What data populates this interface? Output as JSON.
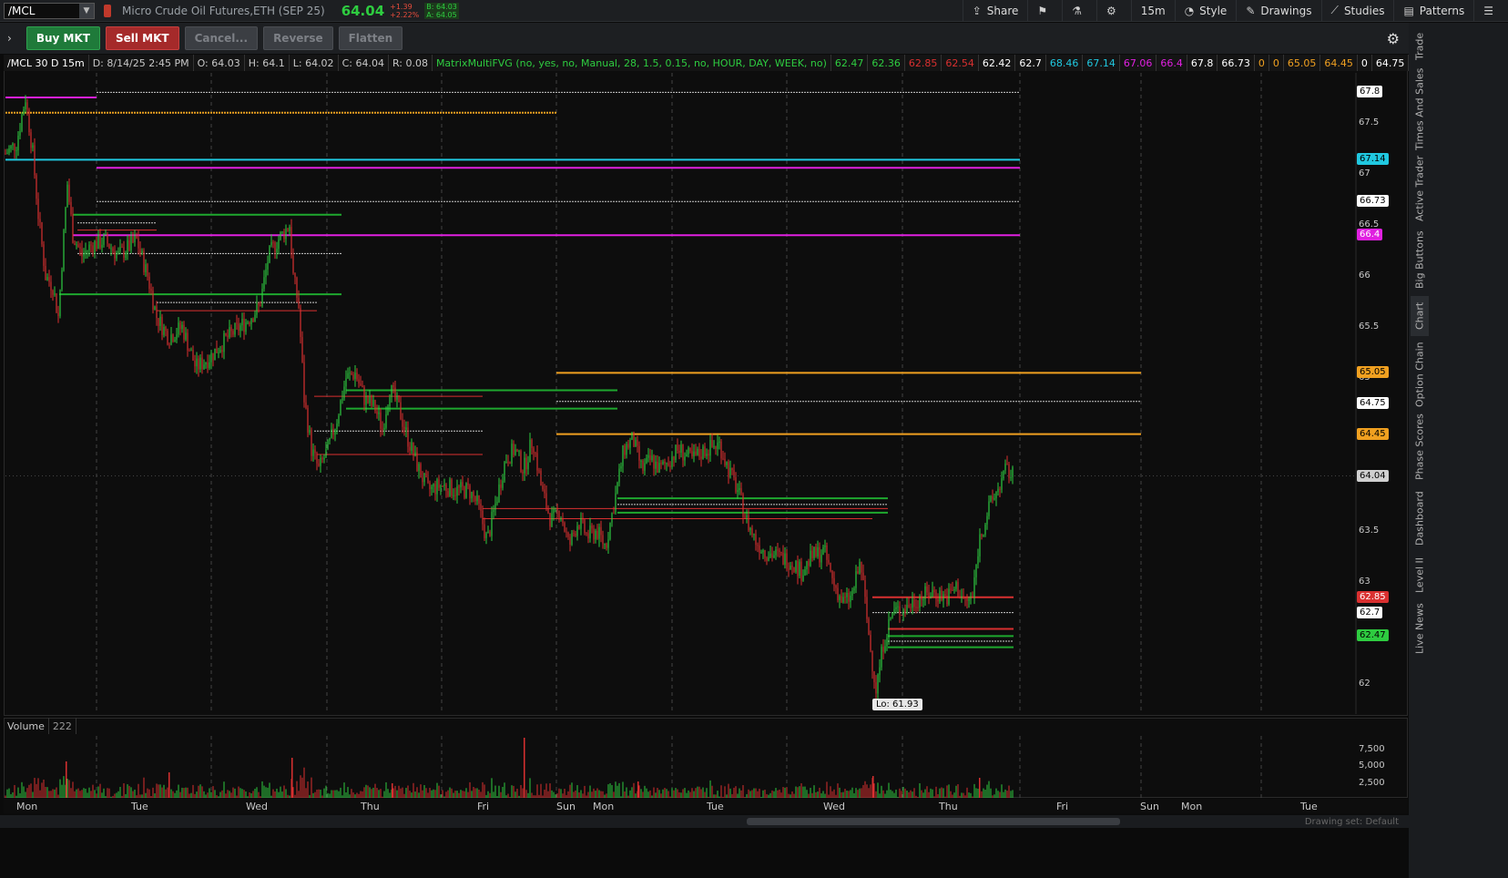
{
  "header": {
    "symbol": "/MCL",
    "description": "Micro Crude Oil Futures,ETH (SEP 25)",
    "last": "64.04",
    "change": "+1.39",
    "change_pct": "+2.22%",
    "bid": "B: 64.03",
    "ask": "A: 64.05",
    "toolbar": {
      "share": "Share",
      "timeframe": "15m",
      "style": "Style",
      "drawings": "Drawings",
      "studies": "Studies",
      "patterns": "Patterns"
    }
  },
  "orderbar": {
    "buy": "Buy MKT",
    "sell": "Sell MKT",
    "cancel": "Cancel...",
    "reverse": "Reverse",
    "flatten": "Flatten"
  },
  "sidetabs": [
    "Trade",
    "Times And Sales",
    "Active Trader",
    "Big Buttons",
    "Chart",
    "Option Chain",
    "Phase Scores",
    "Dashboard",
    "Level II",
    "Live News"
  ],
  "legend": {
    "symbol": "/MCL 30 D 15m",
    "date": "D: 8/14/25 2:45 PM",
    "open": "O: 64.03",
    "high": "H: 64.1",
    "low": "L: 64.02",
    "close": "C: 64.04",
    "range": "R: 0.08",
    "study": "MatrixMultiFVG (no, yes, no, Manual, 28, 1.5, 0.15, no, HOUR, DAY, WEEK, no)",
    "values": [
      {
        "v": "62.47",
        "c": "#2ecc40"
      },
      {
        "v": "62.36",
        "c": "#2ecc40"
      },
      {
        "v": "62.85",
        "c": "#d93030"
      },
      {
        "v": "62.54",
        "c": "#d93030"
      },
      {
        "v": "62.42",
        "c": "#ffffff"
      },
      {
        "v": "62.7",
        "c": "#ffffff"
      },
      {
        "v": "68.46",
        "c": "#20c8e0"
      },
      {
        "v": "67.14",
        "c": "#20c8e0"
      },
      {
        "v": "67.06",
        "c": "#e020e0"
      },
      {
        "v": "66.4",
        "c": "#e020e0"
      },
      {
        "v": "67.8",
        "c": "#ffffff"
      },
      {
        "v": "66.73",
        "c": "#ffffff"
      },
      {
        "v": "0",
        "c": "#f0a020"
      },
      {
        "v": "0",
        "c": "#f0a020"
      },
      {
        "v": "65.05",
        "c": "#f0a020"
      },
      {
        "v": "64.45",
        "c": "#f0a020"
      },
      {
        "v": "0",
        "c": "#ffffff"
      },
      {
        "v": "64.75",
        "c": "#ffffff"
      }
    ]
  },
  "price_axis": [
    "67.5",
    "67",
    "66.5",
    "66",
    "65.5",
    "65",
    "63.5",
    "63",
    "62"
  ],
  "price_tags": [
    {
      "v": "67.8",
      "bg": "#ffffff",
      "fg": "#000000",
      "p": 67.8
    },
    {
      "v": "67.14",
      "bg": "#20c8e0",
      "fg": "#000000",
      "p": 67.14
    },
    {
      "v": "66.73",
      "bg": "#ffffff",
      "fg": "#000000",
      "p": 66.73
    },
    {
      "v": "66.4",
      "bg": "#e020e0",
      "fg": "#ffffff",
      "p": 66.4
    },
    {
      "v": "65.05",
      "bg": "#f0a020",
      "fg": "#000000",
      "p": 65.05
    },
    {
      "v": "64.75",
      "bg": "#ffffff",
      "fg": "#000000",
      "p": 64.75
    },
    {
      "v": "64.45",
      "bg": "#f0a020",
      "fg": "#000000",
      "p": 64.45
    },
    {
      "v": "64.04",
      "bg": "#d0d0d0",
      "fg": "#000000",
      "p": 64.04
    },
    {
      "v": "62.85",
      "bg": "#d93030",
      "fg": "#ffffff",
      "p": 62.85
    },
    {
      "v": "62.7",
      "bg": "#ffffff",
      "fg": "#000000",
      "p": 62.7
    },
    {
      "v": "62.47",
      "bg": "#2ecc40",
      "fg": "#000000",
      "p": 62.47
    }
  ],
  "low_label": "Lo: 61.93",
  "volume": {
    "label": "Volume",
    "value": "222",
    "axis": [
      "7,500",
      "5,000",
      "2,500"
    ]
  },
  "time_axis": [
    "Mon",
    "Tue",
    "Wed",
    "Thu",
    "Fri",
    "Sun",
    "Mon",
    "Tue",
    "Wed",
    "Thu",
    "Fri",
    "Sun",
    "Mon",
    "Tue"
  ],
  "drawing_set": "Drawing set: Default",
  "colors": {
    "up": "#2ecc40",
    "down": "#d93030",
    "cyan": "#20c8e0",
    "magenta": "#e020e0",
    "orange": "#f0a020"
  }
}
